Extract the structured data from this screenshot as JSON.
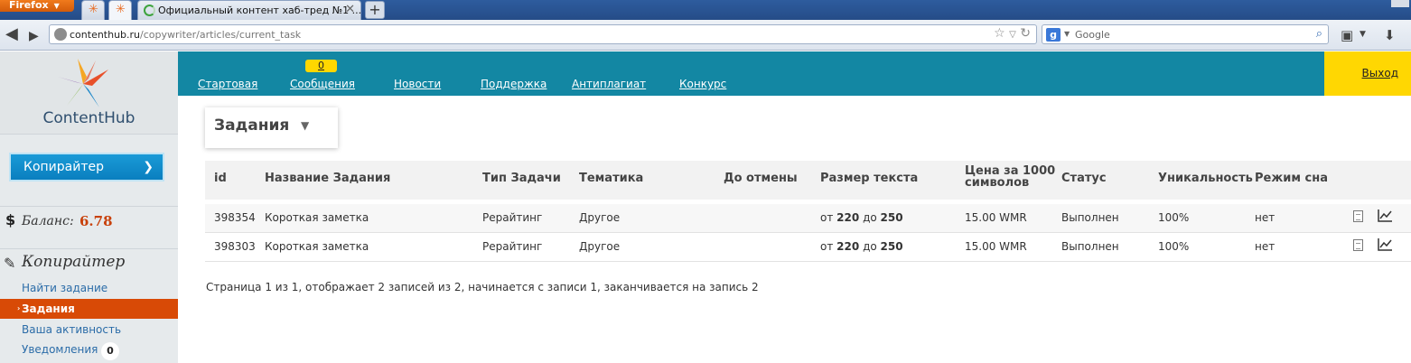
{
  "browser": {
    "app_button": "Firefox",
    "tab_title": "Официальный контент хаб-тред №1 ...",
    "new_tab": "+",
    "url_domain": "contenthub.ru",
    "url_path": "/copywriter/articles/current_task",
    "search_placeholder": "Google",
    "search_engine_icon": "google-icon"
  },
  "sidebar": {
    "logo_text": "ContentHub",
    "role": "Копирайтер",
    "balance_label": "Баланс:",
    "balance_value": "6.78",
    "section_title": "Копирайтер",
    "items": [
      {
        "label": "Найти задание"
      },
      {
        "label": "Задания"
      },
      {
        "label": "Ваша активность"
      },
      {
        "label": "Уведомления",
        "badge": "0"
      }
    ]
  },
  "topnav": {
    "items": [
      "Стартовая",
      "Сообщения",
      "Новости",
      "Поддержка",
      "Антиплагиат",
      "Конкурс"
    ],
    "messages_badge": "0",
    "exit": "Выход"
  },
  "main": {
    "title": "Задания",
    "columns": [
      "id",
      "Название Задания",
      "Тип Задачи",
      "Тематика",
      "До отмены",
      "Размер текста",
      "Цена за 1000 символов",
      "Статус",
      "Уникальность",
      "Режим сна"
    ],
    "price_header_line1": "Цена за 1000",
    "price_header_line2": "символов",
    "rows": [
      {
        "id": "398354",
        "name": "Короткая заметка",
        "type": "Рерайтинг",
        "theme": "Другое",
        "deadline": "",
        "size_from": "от",
        "size_min": "220",
        "size_to": "до",
        "size_max": "250",
        "price": "15.00 WMR",
        "status": "Выполнен",
        "uniqueness": "100%",
        "sleep": "нет"
      },
      {
        "id": "398303",
        "name": "Короткая заметка",
        "type": "Рерайтинг",
        "theme": "Другое",
        "deadline": "",
        "size_from": "от",
        "size_min": "220",
        "size_to": "до",
        "size_max": "250",
        "price": "15.00 WMR",
        "status": "Выполнен",
        "uniqueness": "100%",
        "sleep": "нет"
      }
    ],
    "pager": "Страница 1 из 1, отображает 2 записей из 2, начинается с записи 1, заканчивается на запись 2"
  },
  "colors": {
    "topnav": "#1387a3",
    "exit_bg": "#ffd702",
    "active_item": "#d84a06",
    "role_button": "#0a7fbf",
    "balance": "#c8410b"
  }
}
